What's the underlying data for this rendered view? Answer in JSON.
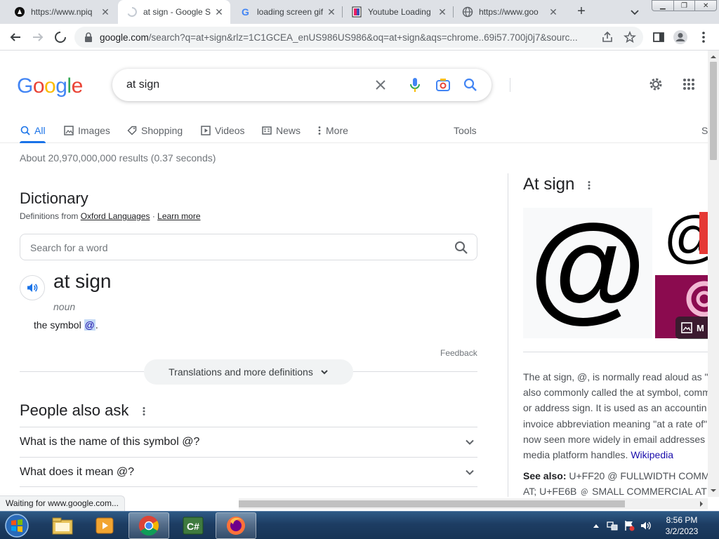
{
  "browser": {
    "tabs": [
      {
        "title": "https://www.npiq",
        "favicon": "npi-favicon"
      },
      {
        "title": "at sign - Google S",
        "favicon": "loading-spinner-icon",
        "active": true
      },
      {
        "title": "loading screen gif",
        "favicon": "google-favicon"
      },
      {
        "title": "Youtube Loading",
        "favicon": "gif-favicon"
      },
      {
        "title": "https://www.goo",
        "favicon": "globe-icon"
      }
    ],
    "url_host": "google.com",
    "url_rest": "/search?q=at+sign&rlz=1C1GCEA_enUS986US986&oq=at+sign&aqs=chrome..69i57.700j0j7&sourc..."
  },
  "search": {
    "logo": "Google",
    "query": "at sign"
  },
  "nav_tabs": [
    "All",
    "Images",
    "Shopping",
    "Videos",
    "News",
    "More",
    "Tools",
    "S"
  ],
  "result_stats": "About 20,970,000,000 results (0.37 seconds)",
  "dictionary": {
    "title": "Dictionary",
    "source_prefix": "Definitions from",
    "source_link": "Oxford Languages",
    "learn_more": "Learn more",
    "search_placeholder": "Search for a word",
    "word": "at sign",
    "pos": "noun",
    "definition_prefix": "the symbol",
    "definition_symbol": "@",
    "definition_suffix": ".",
    "feedback": "Feedback",
    "translations_button": "Translations and more definitions"
  },
  "people_also_ask": {
    "title": "People also ask",
    "questions": [
      "What is the name of this symbol @?",
      "What does it mean @?"
    ]
  },
  "knowledge_panel": {
    "title": "At sign",
    "image_symbol": "@",
    "more_images_label": "M",
    "description_lines": [
      "The at sign, @, is normally read aloud as \"",
      "also commonly called the at symbol, comm",
      "or address sign. It is used as an accountin",
      "invoice abbreviation meaning \"at a rate of\"",
      "now seen more widely in email addresses",
      "media platform handles. "
    ],
    "wikipedia_link": "Wikipedia",
    "see_also_label": "See also:",
    "see_also_line1": " U+FF20 @ FULLWIDTH COMM",
    "see_also_line2": "AT; U+FE6B ﹫ SMALL COMMERCIAL AT"
  },
  "status_text": "Waiting for www.google.com...",
  "taskbar": {
    "time": "8:56 PM",
    "date": "3/2/2023",
    "apps": [
      "windows-explorer",
      "media-player",
      "chrome",
      "csharp-editor",
      "firefox"
    ]
  }
}
